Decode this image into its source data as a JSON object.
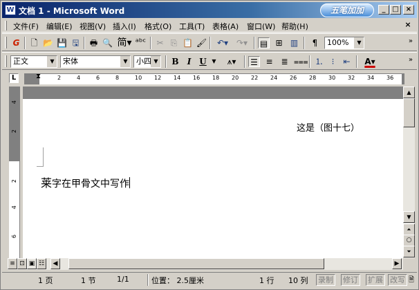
{
  "titlebar": {
    "icon": "W",
    "title": "文档 1 - Microsoft Word",
    "brand": "五笔加加",
    "minimize": "_",
    "maximize": "□",
    "close": "×"
  },
  "menubar": {
    "items": [
      "文件(F)",
      "编辑(E)",
      "视图(V)",
      "插入(I)",
      "格式(O)",
      "工具(T)",
      "表格(A)",
      "窗口(W)",
      "帮助(H)"
    ],
    "close": "×"
  },
  "toolbar1": {
    "zoom": "100%",
    "traditional": "简"
  },
  "toolbar2": {
    "style": "正文",
    "font": "宋体",
    "size": "小四",
    "bold": "B",
    "italic": "I",
    "underline": "U",
    "font_color_glyph": "A",
    "font_color": "#cc0000"
  },
  "ruler": {
    "ticks": [
      "2",
      "4",
      "6",
      "8",
      "10",
      "12",
      "14",
      "16",
      "18",
      "20",
      "22",
      "24",
      "26",
      "28",
      "30",
      "32",
      "34",
      "36"
    ],
    "corner": "L"
  },
  "vruler": {
    "ticks": [
      "4",
      "2",
      "2",
      "4",
      "6"
    ]
  },
  "document": {
    "caption": "这是（图十七）",
    "line_first_char": "莱",
    "line_rest": "字在甲骨文中写作"
  },
  "statusbar": {
    "page": "1 页",
    "section": "1 节",
    "page_of": "1/1",
    "position": "位置： 2.5厘米",
    "line": "1 行",
    "column": "10 列",
    "rec": "录制",
    "track": "修订",
    "extend": "扩展",
    "overtype": "改写"
  }
}
